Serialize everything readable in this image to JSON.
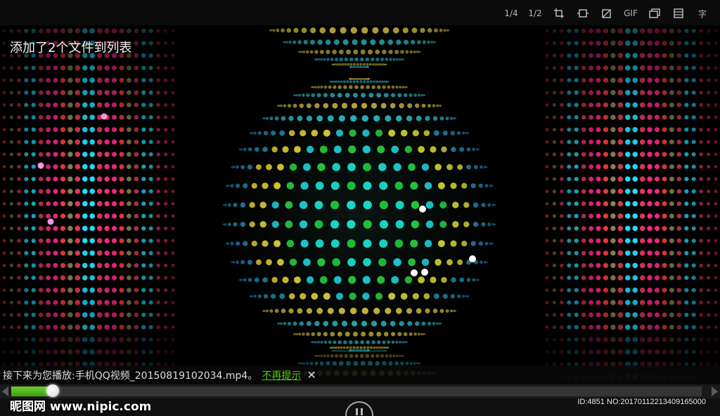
{
  "toolbar": {
    "items": [
      {
        "label": "1/4",
        "icon": "quarter-size-icon"
      },
      {
        "label": "1/2",
        "icon": "half-size-icon"
      },
      {
        "label": "",
        "icon": "crop-icon"
      },
      {
        "label": "",
        "icon": "fit-frame-icon"
      },
      {
        "label": "",
        "icon": "rotate-icon"
      },
      {
        "label": "GIF",
        "icon": "gif-icon"
      },
      {
        "label": "",
        "icon": "window-icon"
      },
      {
        "label": "",
        "icon": "screenshot-icon"
      },
      {
        "label": "字",
        "icon": "subtitle-icon"
      }
    ]
  },
  "toast": {
    "text": "添加了2个文件到列表"
  },
  "next_up": {
    "prefix": "接下来为您播放:手机QQ视频_20150819102034.mp4。",
    "dismiss_label": "不再提示",
    "close_label": "✕"
  },
  "progress": {
    "fraction": 0.06
  },
  "watermark": {
    "left": "昵图网 www.nipic.com",
    "right": "ID:4851 NO:20170112213409165000"
  },
  "colors": {
    "accent": "#52c414",
    "progress_fill": "#4fae1a",
    "background": "#000000"
  }
}
